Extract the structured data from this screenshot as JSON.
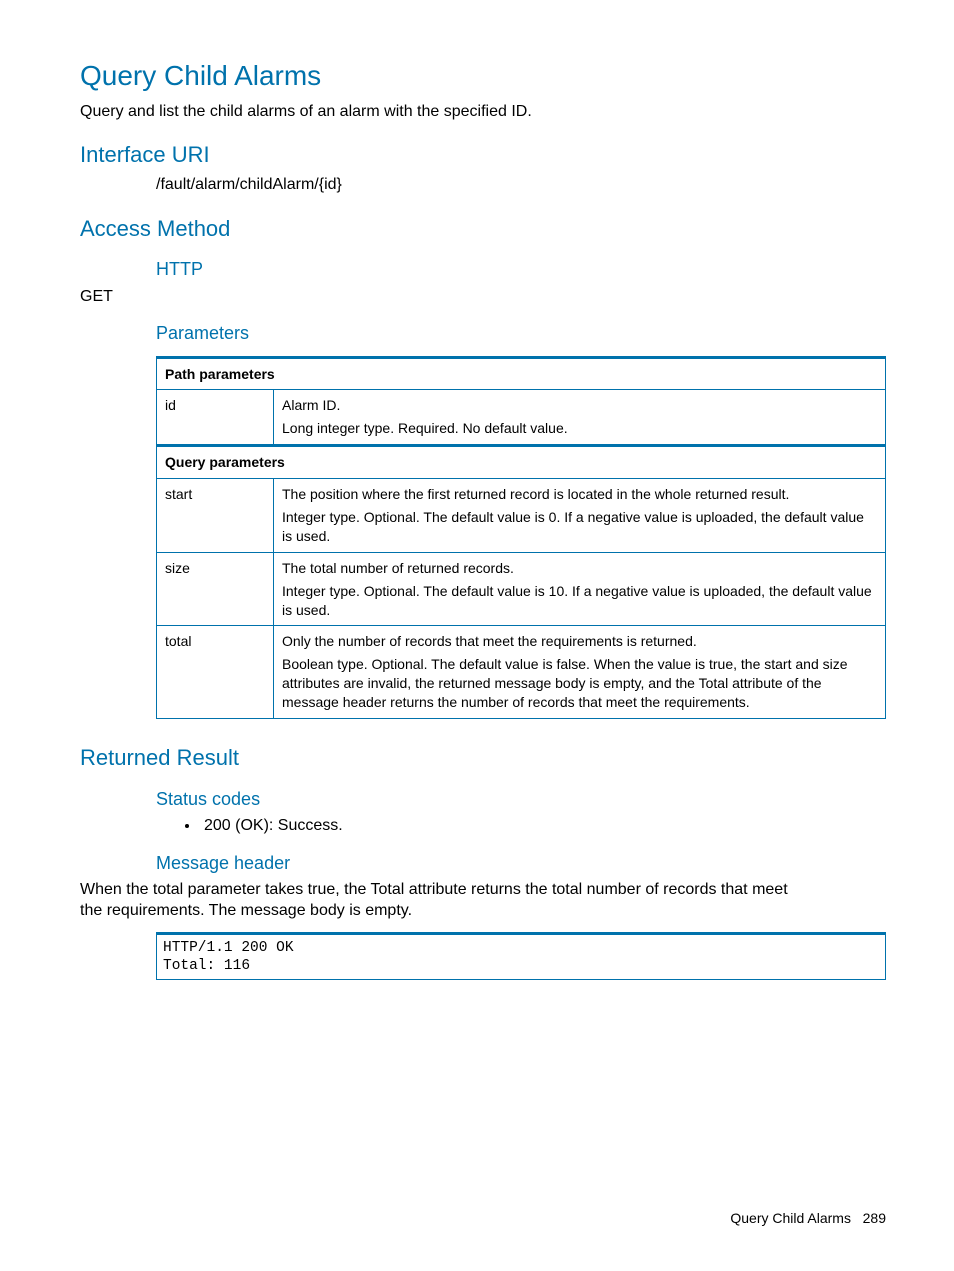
{
  "title": "Query Child Alarms",
  "intro": "Query and list the child alarms of an alarm with the specified ID.",
  "interface_uri": {
    "heading": "Interface URI",
    "value": "/fault/alarm/childAlarm/{id}"
  },
  "access_method": {
    "heading": "Access Method",
    "http_heading": "HTTP",
    "http_value": "GET",
    "parameters_heading": "Parameters",
    "path_header": "Path parameters",
    "query_header": "Query parameters",
    "path_params": {
      "id": {
        "name": "id",
        "line1": "Alarm ID.",
        "line2": "Long integer type. Required. No default value."
      }
    },
    "query_params": {
      "start": {
        "name": "start",
        "line1": "The position where the first returned record is located in the whole returned result.",
        "line2": "Integer type. Optional. The default value is 0. If a negative value is uploaded, the default value is used."
      },
      "size": {
        "name": "size",
        "line1": "The total number of returned records.",
        "line2": "Integer type. Optional. The default value is 10. If a negative value is uploaded, the default value is used."
      },
      "total": {
        "name": "total",
        "line1": "Only the number of records that meet the requirements is returned.",
        "line2": "Boolean type. Optional. The default value is false. When the value is true, the start and size attributes are invalid, the returned message body is empty, and the Total attribute of the message header returns the number of records that meet the requirements."
      }
    }
  },
  "returned_result": {
    "heading": "Returned Result",
    "status_codes_heading": "Status codes",
    "status_code_1": "200 (OK): Success.",
    "message_header_heading": "Message header",
    "message_header_text": "When the total parameter takes true, the Total attribute returns the total number of records that meet the requirements. The message body is empty.",
    "code": "HTTP/1.1 200 OK\nTotal: 116"
  },
  "footer": {
    "title": "Query Child Alarms",
    "page": "289"
  }
}
